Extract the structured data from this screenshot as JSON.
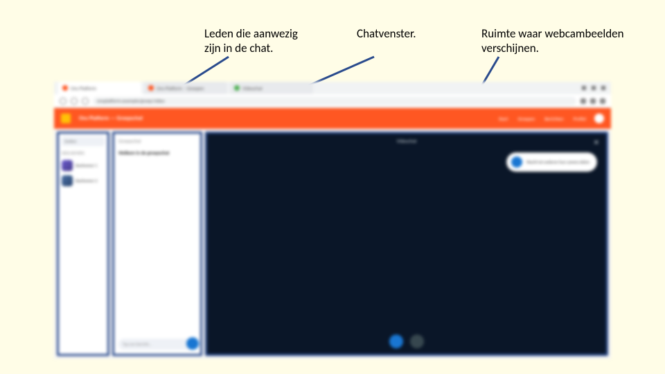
{
  "labels": {
    "members": "Leden die aanwezig\nzijn in de chat.",
    "chat": "Chatvenster.",
    "video": "Ruimte waar webcambeelden\nverschijnen."
  },
  "browser": {
    "tabs": [
      {
        "label": "Ons Platform",
        "dot": "#ff5722"
      },
      {
        "label": "Ons Platform – Groepen",
        "dot": "#ff5722"
      },
      {
        "label": "Videochat",
        "dot": "#4caf50"
      }
    ],
    "url": "onsplatform.example/groep/video"
  },
  "orgbar": {
    "title": "Ons Platform — Groepschat",
    "links": [
      "Start",
      "Groepen",
      "Berichten",
      "Profiel"
    ]
  },
  "membersPanel": {
    "search": "Zoeken",
    "heading": "Deelnemers",
    "members": [
      "Deelnemer 1",
      "Deelnemer 2"
    ]
  },
  "chatPanel": {
    "title": "Groepschat",
    "welcome": "Welkom in de groepschat",
    "inputPlaceholder": "Typ een bericht…"
  },
  "videoPanel": {
    "title": "Videochat",
    "notice": "Wacht tot anderen hun camera delen"
  }
}
